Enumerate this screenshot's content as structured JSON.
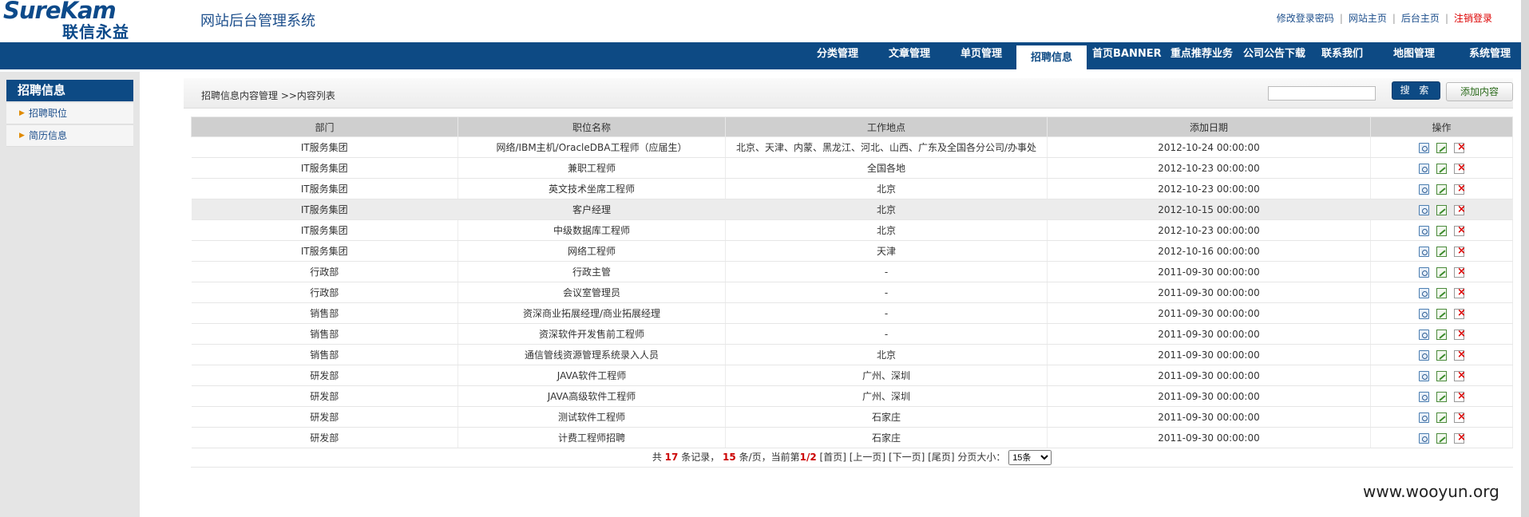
{
  "header": {
    "logo_text": "SureKam",
    "logo_cn": "联信永益",
    "title": "网站后台管理系统",
    "links": [
      "修改登录密码",
      "网站主页",
      "后台主页"
    ],
    "logout": "注销登录"
  },
  "nav": {
    "items": [
      "分类管理",
      "文章管理",
      "单页管理",
      "招聘信息",
      "首页BANNER",
      "重点推荐业务",
      "公司公告下载",
      "联系我们",
      "地图管理",
      "系统管理"
    ],
    "active": "招聘信息"
  },
  "sidebar": {
    "title": "招聘信息",
    "items": [
      "招聘职位",
      "简历信息"
    ]
  },
  "content": {
    "breadcrumb": "招聘信息内容管理 >>内容列表",
    "search_value": "",
    "search_button": "搜 索",
    "add_button": "添加内容"
  },
  "table": {
    "columns": [
      "部门",
      "职位名称",
      "工作地点",
      "添加日期",
      "操作"
    ],
    "rows": [
      {
        "dept": "IT服务集团",
        "title": "网络/IBM主机/OracleDBA工程师（应届生）",
        "location": "北京、天津、内蒙、黑龙江、河北、山西、广东及全国各分公司/办事处",
        "date": "2012-10-24 00:00:00"
      },
      {
        "dept": "IT服务集团",
        "title": "兼职工程师",
        "location": "全国各地",
        "date": "2012-10-23 00:00:00"
      },
      {
        "dept": "IT服务集团",
        "title": "英文技术坐席工程师",
        "location": "北京",
        "date": "2012-10-23 00:00:00"
      },
      {
        "dept": "IT服务集团",
        "title": "客户经理",
        "location": "北京",
        "date": "2012-10-15 00:00:00"
      },
      {
        "dept": "IT服务集团",
        "title": "中级数据库工程师",
        "location": "北京",
        "date": "2012-10-23 00:00:00"
      },
      {
        "dept": "IT服务集团",
        "title": "网络工程师",
        "location": "天津",
        "date": "2012-10-16 00:00:00"
      },
      {
        "dept": "行政部",
        "title": "行政主管",
        "location": "-",
        "date": "2011-09-30 00:00:00"
      },
      {
        "dept": "行政部",
        "title": "会议室管理员",
        "location": "-",
        "date": "2011-09-30 00:00:00"
      },
      {
        "dept": "销售部",
        "title": "资深商业拓展经理/商业拓展经理",
        "location": "-",
        "date": "2011-09-30 00:00:00"
      },
      {
        "dept": "销售部",
        "title": "资深软件开发售前工程师",
        "location": "-",
        "date": "2011-09-30 00:00:00"
      },
      {
        "dept": "销售部",
        "title": "通信管线资源管理系统录入人员",
        "location": "北京",
        "date": "2011-09-30 00:00:00"
      },
      {
        "dept": "研发部",
        "title": "JAVA软件工程师",
        "location": "广州、深圳",
        "date": "2011-09-30 00:00:00"
      },
      {
        "dept": "研发部",
        "title": "JAVA高级软件工程师",
        "location": "广州、深圳",
        "date": "2011-09-30 00:00:00"
      },
      {
        "dept": "研发部",
        "title": "测试软件工程师",
        "location": "石家庄",
        "date": "2011-09-30 00:00:00"
      },
      {
        "dept": "研发部",
        "title": "计费工程师招聘",
        "location": "石家庄",
        "date": "2011-09-30 00:00:00"
      }
    ],
    "highlighted_row": 3
  },
  "pager": {
    "total_prefix": "共",
    "total": "17",
    "total_suffix": "条记录，",
    "per_page": "15",
    "per_page_suffix": "条/页，当前第",
    "current": "1/2",
    "first": "[首页]",
    "prev": "[上一页]",
    "next": "[下一页]",
    "last": "[尾页]",
    "size_label": "分页大小：",
    "size_value": "15条"
  },
  "watermark": "www.wooyun.org"
}
